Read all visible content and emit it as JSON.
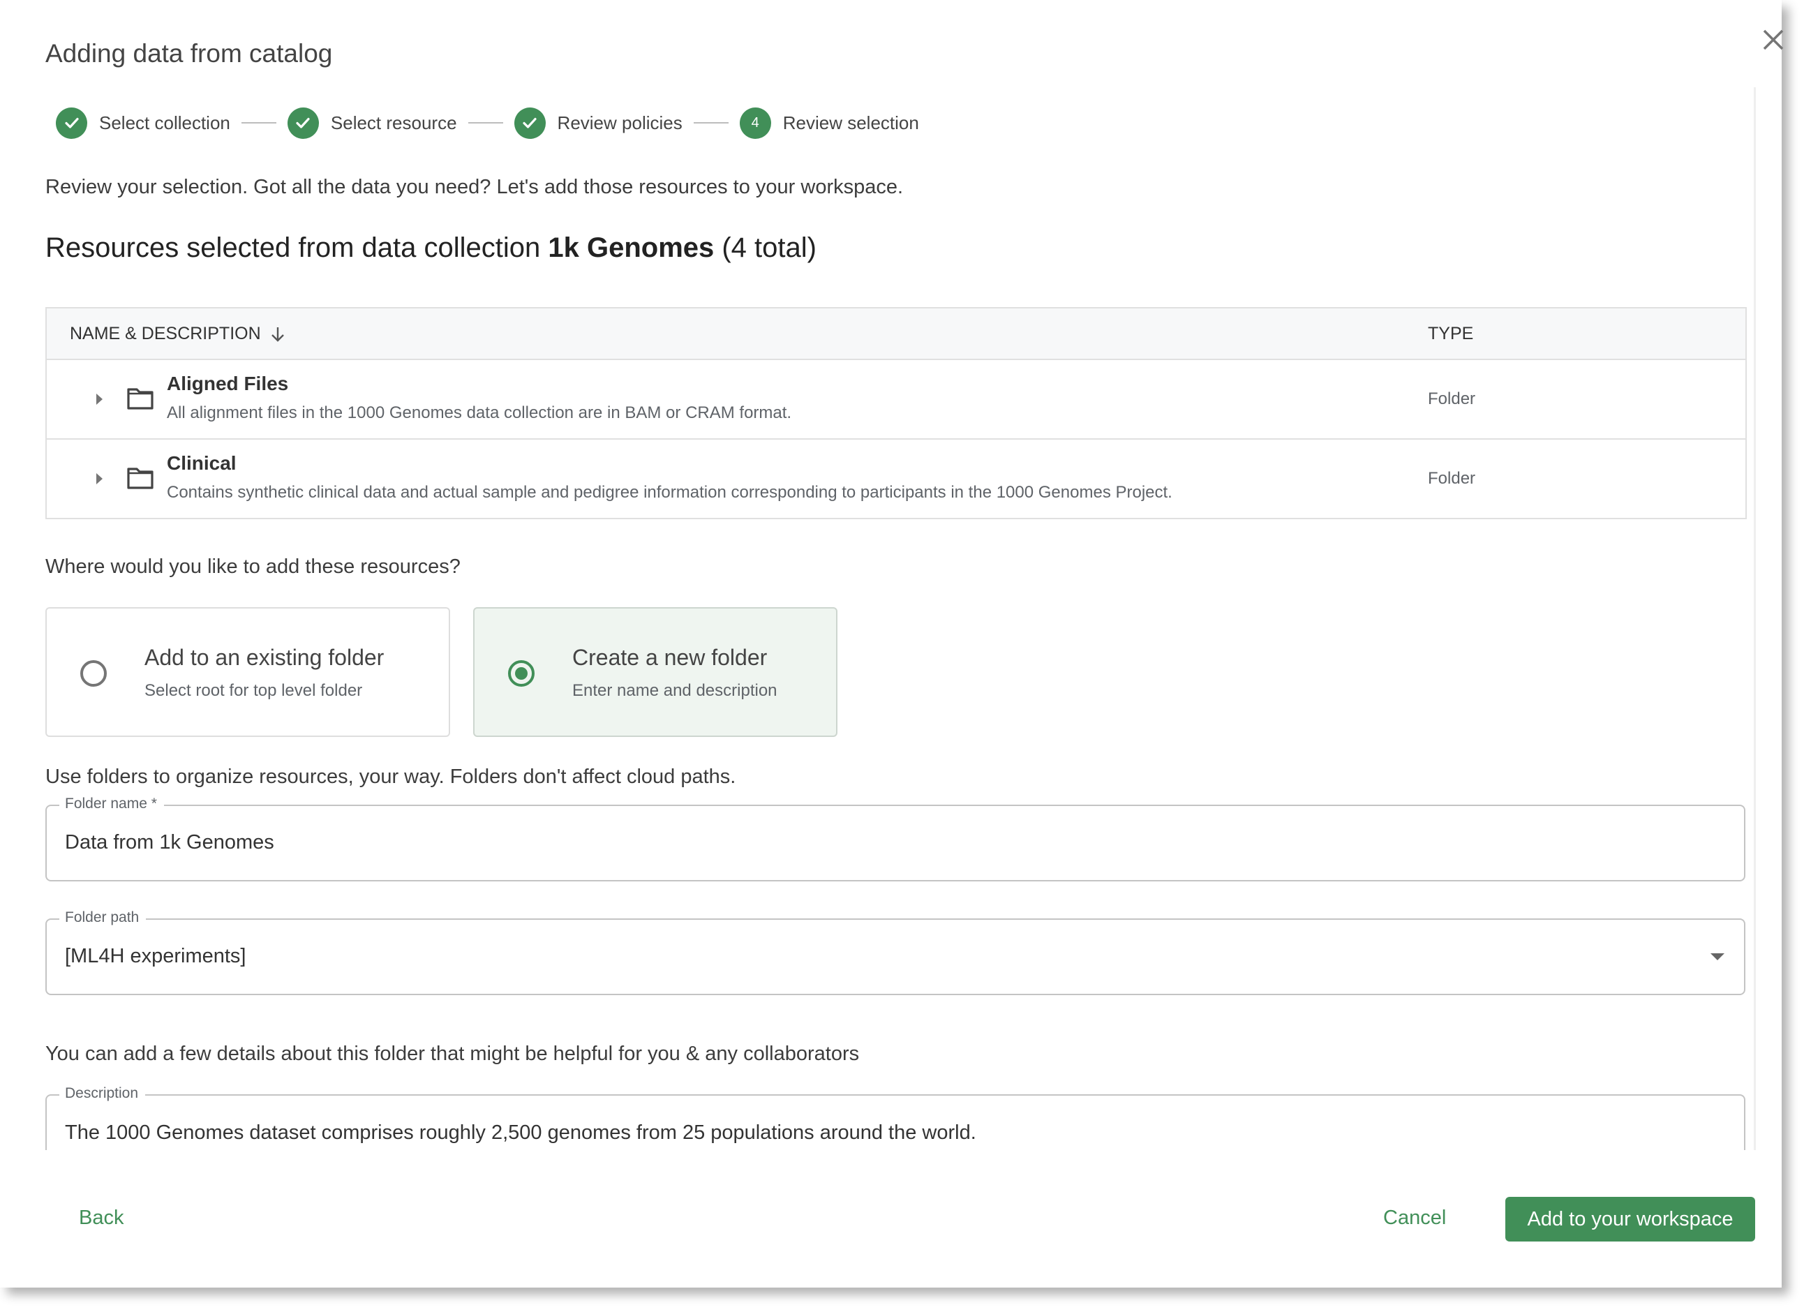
{
  "dialog": {
    "title": "Adding data from catalog",
    "close_icon": "close-icon"
  },
  "stepper": {
    "steps": [
      {
        "label": "Select collection",
        "status": "complete",
        "marker": "✓"
      },
      {
        "label": "Select resource",
        "status": "complete",
        "marker": "✓"
      },
      {
        "label": "Review policies",
        "status": "complete",
        "marker": "✓"
      },
      {
        "label": "Review selection",
        "status": "current",
        "marker": "4"
      }
    ]
  },
  "intro": "Review your selection. Got all the data you need? Let's add those resources to your workspace.",
  "heading": {
    "prefix": "Resources selected from data collection ",
    "collection": "1k Genomes",
    "suffix": " (4 total)"
  },
  "table": {
    "columns": {
      "name": "NAME & DESCRIPTION",
      "type": "TYPE"
    },
    "sort_icon": "arrow-down-icon",
    "rows": [
      {
        "name": "Aligned Files",
        "description": "All alignment files in the 1000 Genomes data collection are in BAM or CRAM format.",
        "type": "Folder"
      },
      {
        "name": "Clinical",
        "description": "Contains synthetic clinical data and actual sample and pedigree information corresponding to participants in the 1000 Genomes Project.",
        "type": "Folder"
      }
    ]
  },
  "destination": {
    "question": "Where would you like to add these resources?",
    "options": [
      {
        "title": "Add to an existing folder",
        "subtitle": "Select root for top level folder",
        "selected": false
      },
      {
        "title": "Create a new folder",
        "subtitle": "Enter name and description",
        "selected": true
      }
    ]
  },
  "form": {
    "hint": "Use folders to organize resources, your way. Folders don't affect cloud paths.",
    "folder_name": {
      "label": "Folder name *",
      "value": "Data from 1k Genomes"
    },
    "folder_path": {
      "label": "Folder path",
      "value": "[ML4H experiments]"
    },
    "details_hint": "You can add a few details about this folder that might be helpful for you & any collaborators",
    "description": {
      "label": "Description",
      "value": "The 1000 Genomes dataset comprises roughly 2,500 genomes from 25 populations around the world."
    }
  },
  "footer": {
    "back": "Back",
    "cancel": "Cancel",
    "submit": "Add to your workspace"
  },
  "colors": {
    "accent": "#418f58",
    "selected_card_bg": "#eff5f0",
    "table_header_bg": "#f7f8f9"
  }
}
